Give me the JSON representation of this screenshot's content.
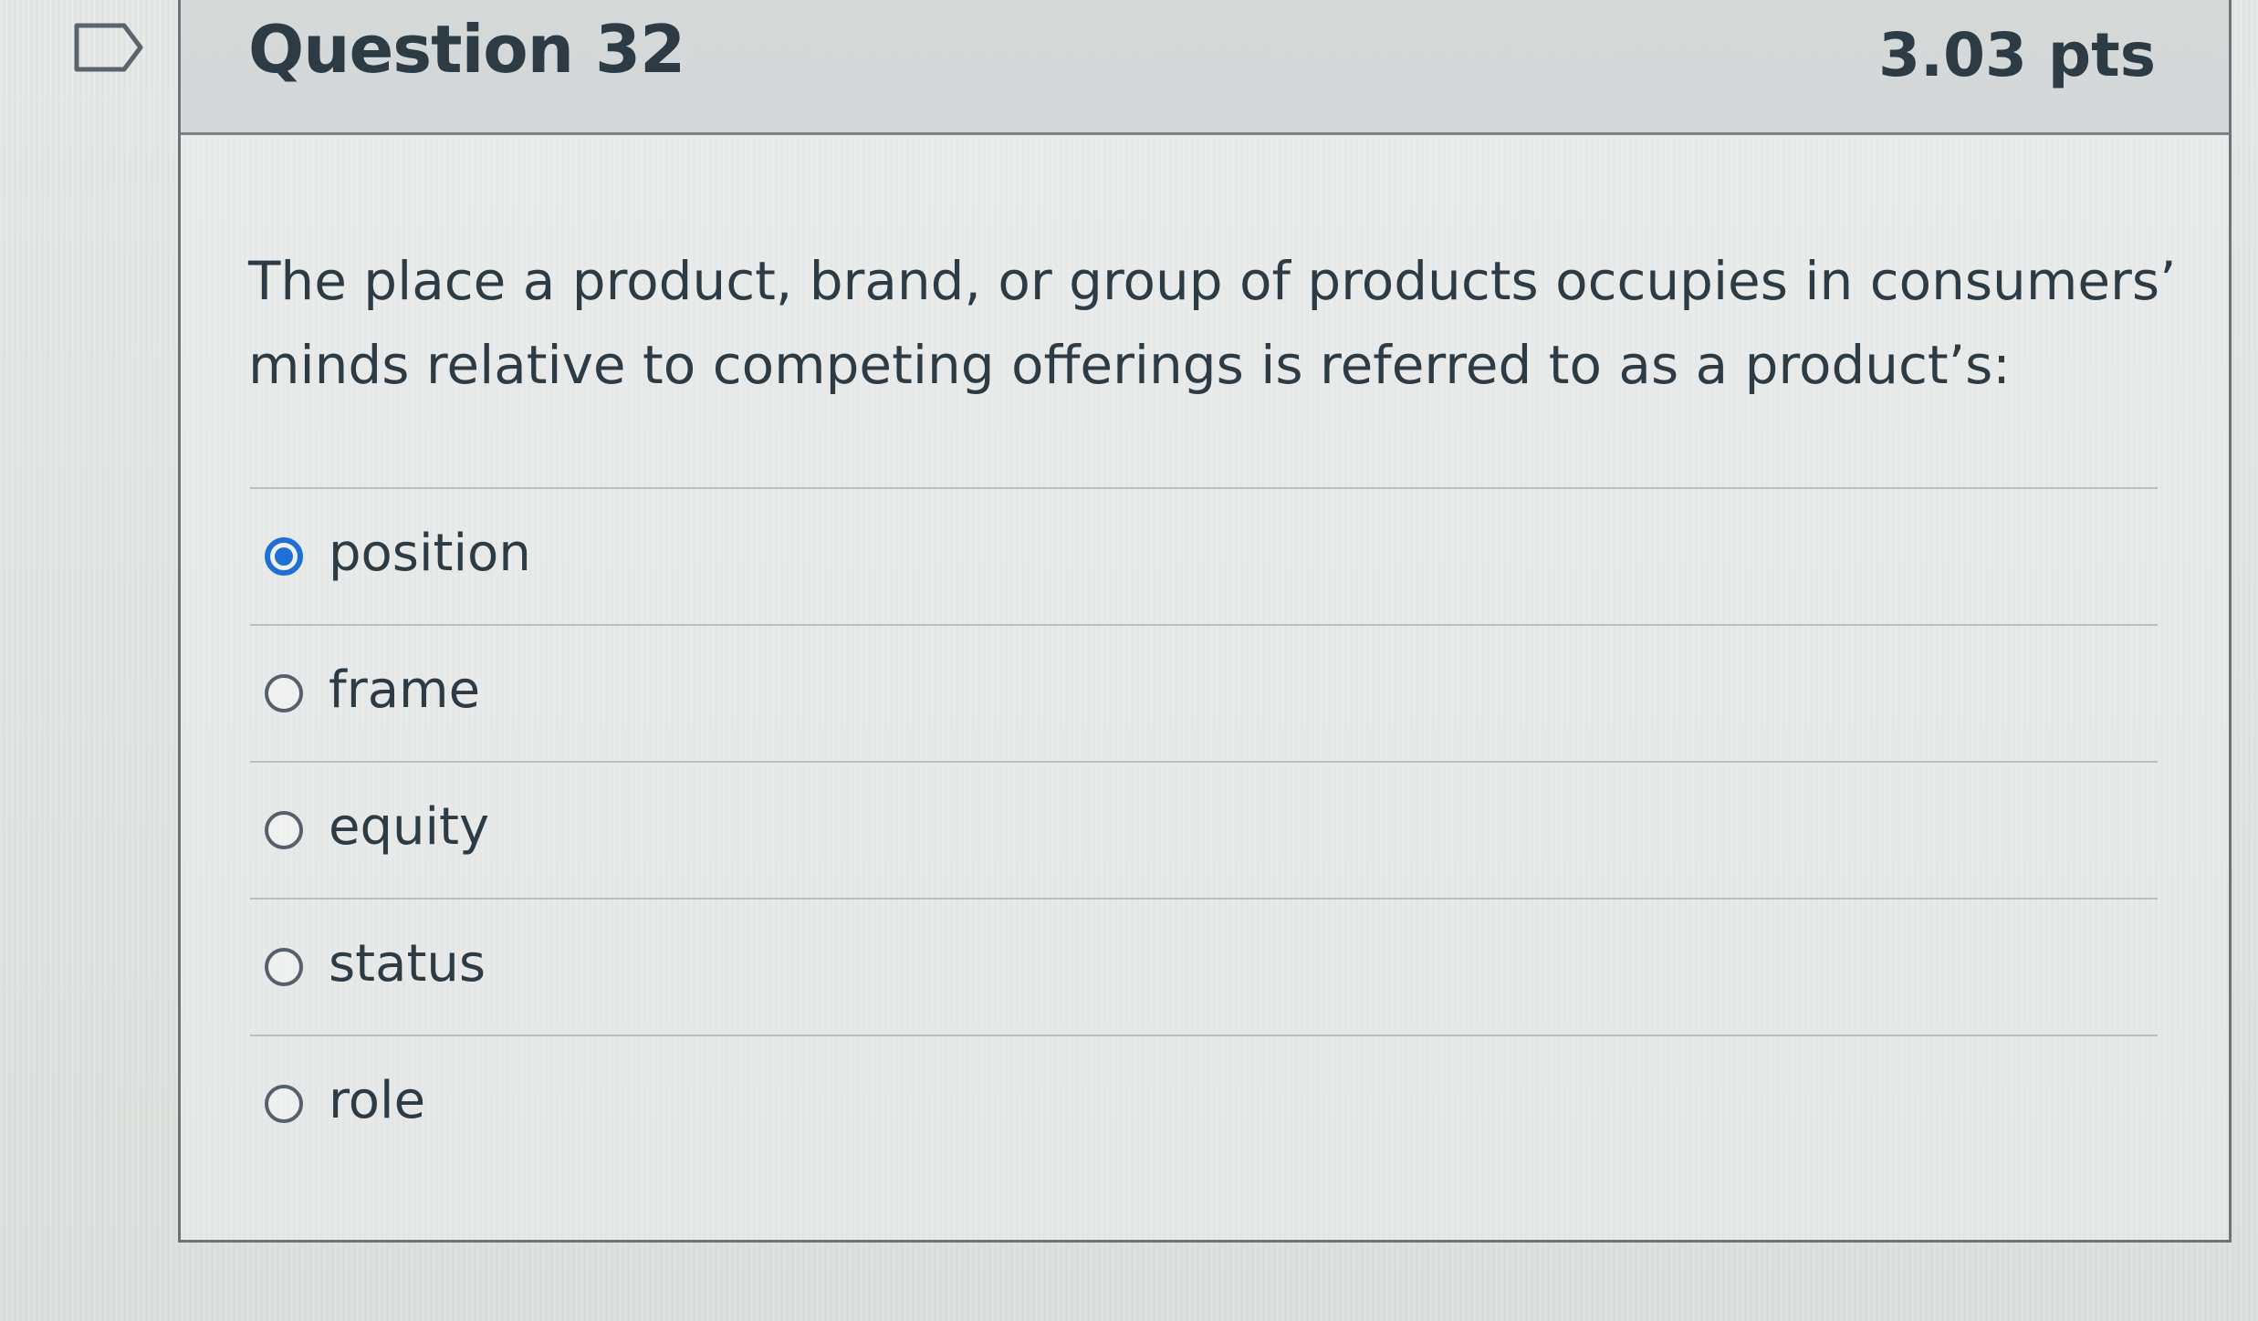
{
  "question": {
    "title": "Question 32",
    "points": "3.03 pts",
    "text": "The place a product, brand, or group of products occupies in consumers’ minds relative to competing offerings is referred to as a product’s:"
  },
  "answers": [
    {
      "label": "position",
      "selected": true
    },
    {
      "label": "frame",
      "selected": false
    },
    {
      "label": "equity",
      "selected": false
    },
    {
      "label": "status",
      "selected": false
    },
    {
      "label": "role",
      "selected": false
    }
  ],
  "icons": {
    "flag": "flag-question-icon",
    "radio_selected": "radio-selected-icon",
    "radio_unselected": "radio-unselected-icon"
  },
  "colors": {
    "accent": "#1f6fd4",
    "text": "#2d3b45",
    "border": "#6d7479"
  }
}
